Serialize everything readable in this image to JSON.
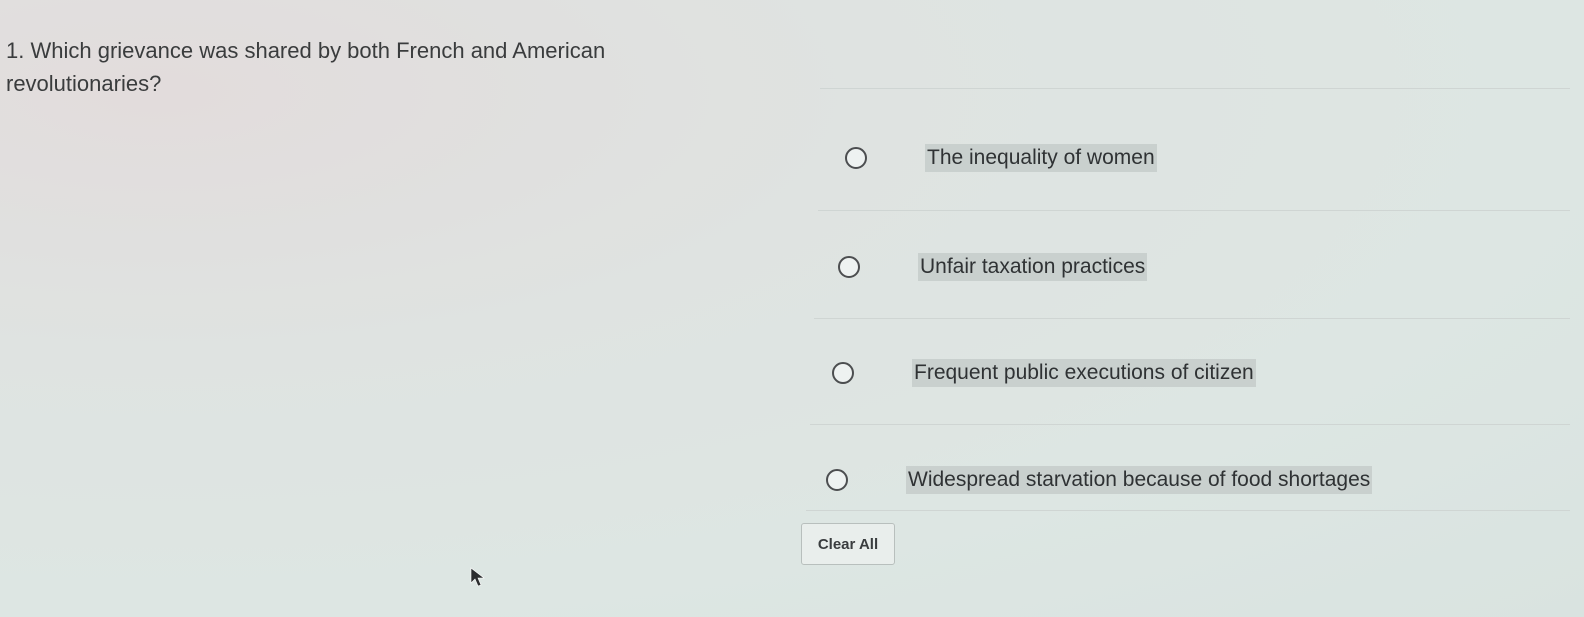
{
  "question": {
    "number": "1.",
    "text": "Which grievance was shared by both French and American revolutionaries?"
  },
  "choices": [
    {
      "label": "The inequality of women",
      "selected": false
    },
    {
      "label": "Unfair taxation practices",
      "selected": false
    },
    {
      "label": "Frequent public executions of citizen",
      "selected": false
    },
    {
      "label": "Widespread starvation because of food shortages",
      "selected": false
    }
  ],
  "clear_button": {
    "label": "Clear All"
  },
  "colors": {
    "background": "#dde6e3",
    "label_highlight": "#c9d0ce",
    "text": "#3a3c3d"
  }
}
